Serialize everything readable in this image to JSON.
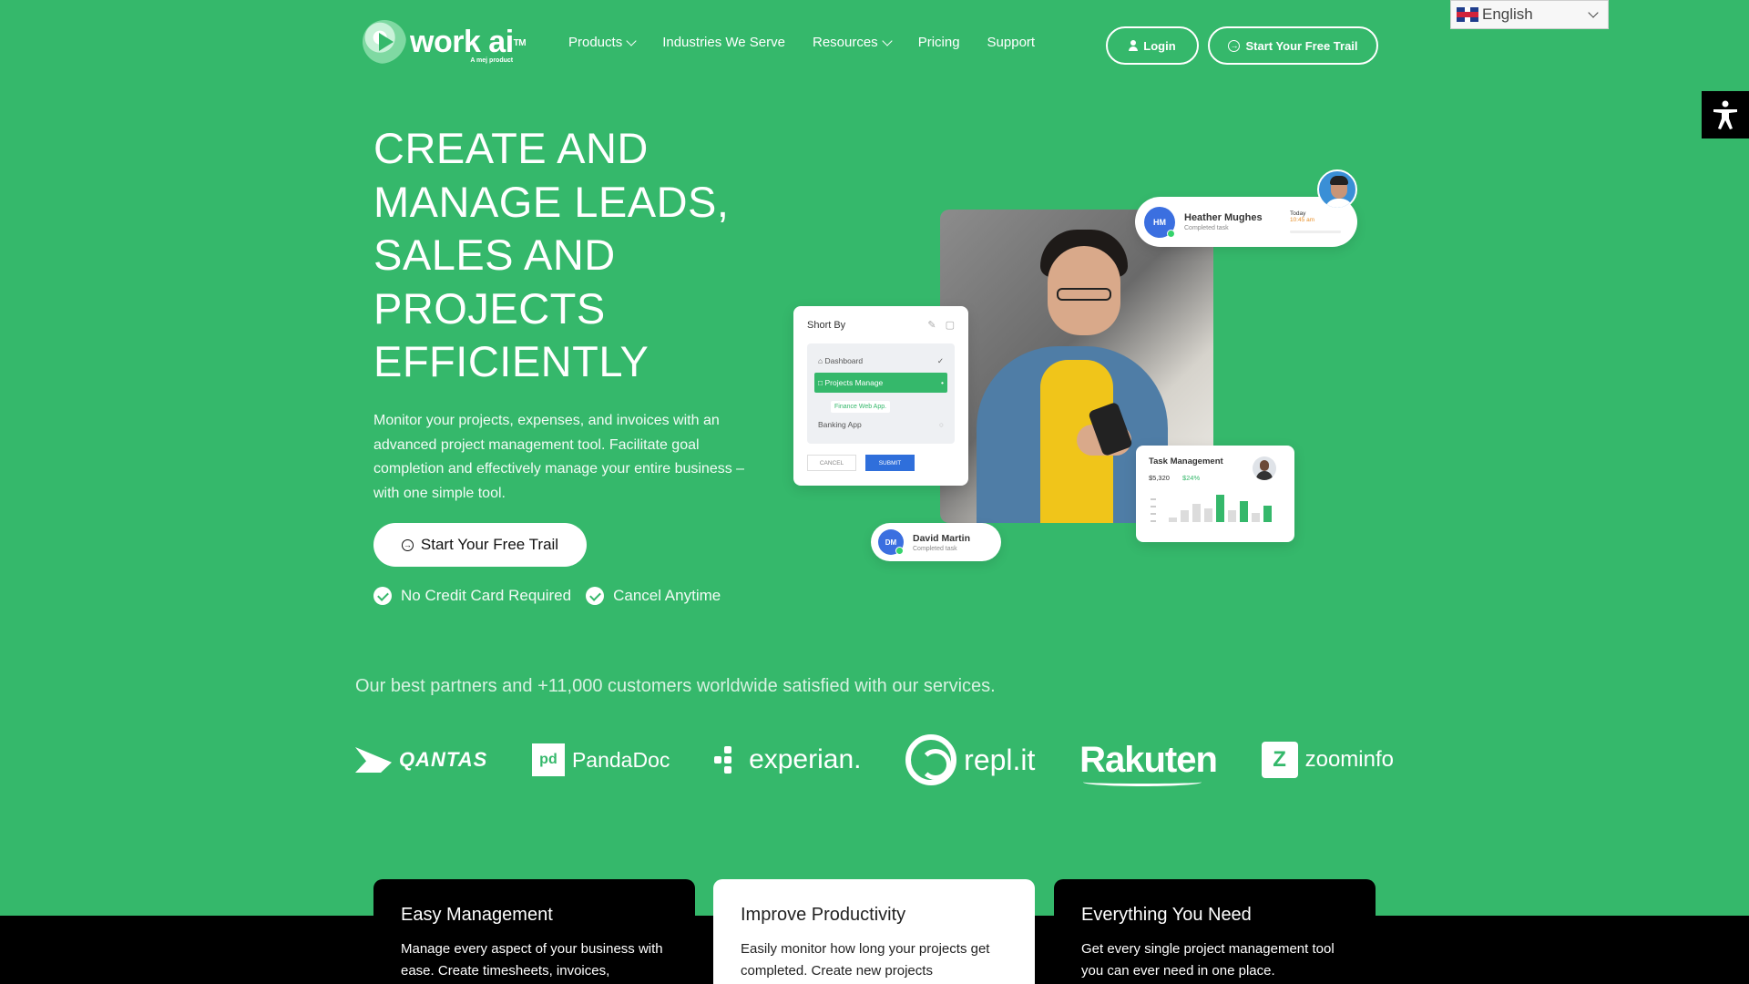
{
  "header": {
    "logo_word": "work ai",
    "logo_tm": "TM",
    "logo_sub": "A mej product",
    "nav": [
      {
        "label": "Products",
        "has_dropdown": true
      },
      {
        "label": "Industries We Serve",
        "has_dropdown": false
      },
      {
        "label": "Resources",
        "has_dropdown": true
      },
      {
        "label": "Pricing",
        "has_dropdown": false
      },
      {
        "label": "Support",
        "has_dropdown": false
      }
    ],
    "login_label": "Login",
    "trial_label": "Start Your Free Trail"
  },
  "language": {
    "selected": "English",
    "icon": "uk-flag-icon"
  },
  "accessibility": {
    "icon": "accessibility-icon"
  },
  "hero": {
    "title": "CREATE AND MANAGE LEADS, SALES AND PROJECTS EFFICIENTLY",
    "description": "Monitor your projects, expenses, and invoices with an advanced project management tool. Facilitate goal completion and effectively manage your entire business – with one simple tool.",
    "cta_label": "Start Your Free Trail",
    "checks": [
      "No Credit Card Required",
      "Cancel Anytime"
    ]
  },
  "illustration": {
    "sort_card": {
      "title": "Short By",
      "rows": [
        "Dashboard",
        "Projects Manage",
        "Finance Web App.",
        "Banking App"
      ],
      "cancel": "CANCEL",
      "submit": "SUBMIT"
    },
    "heather": {
      "initials": "HM",
      "name": "Heather Mughes",
      "status": "Completed task",
      "today": "Today",
      "time": "10:45 am"
    },
    "david": {
      "initials": "DM",
      "name": "David Martin",
      "status": "Completed task"
    },
    "task": {
      "title": "Task Management",
      "amount": "$5,320",
      "change": "$24%",
      "bars": [
        0.1,
        0.25,
        0.4,
        0.3,
        0.6,
        0.25,
        0.45,
        0.2,
        0.35
      ]
    }
  },
  "partners": {
    "text": "Our best partners and +11,000 customers worldwide satisfied with our services.",
    "logos": [
      "QANTAS",
      "PandaDoc",
      "experian.",
      "repl.it",
      "Rakuten",
      "zoominfo"
    ]
  },
  "features": [
    {
      "title": "Easy Management",
      "text": "Manage every aspect of your business with ease. Create timesheets, invoices,"
    },
    {
      "title": "Improve Productivity",
      "text": "Easily monitor how long your projects get completed. Create new projects"
    },
    {
      "title": "Everything You Need",
      "text": "Get every single project management tool you can ever need in one place."
    }
  ],
  "colors": {
    "brand_green": "#35b86b",
    "dark": "#000000",
    "submit_blue": "#2f6fdb"
  }
}
